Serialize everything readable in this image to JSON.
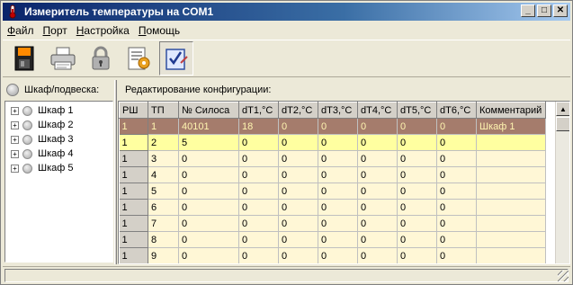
{
  "window": {
    "title": "Измеритель температуры на COM1",
    "minimize": "_",
    "maximize": "□",
    "close": "✕"
  },
  "menu": [
    {
      "label": "Файл",
      "mnemonic": "Ф",
      "rest": "айл"
    },
    {
      "label": "Порт",
      "mnemonic": "П",
      "rest": "орт"
    },
    {
      "label": "Настройка",
      "mnemonic": "Н",
      "rest": "астройка"
    },
    {
      "label": "Помощь",
      "mnemonic": "П",
      "rest": "омощь"
    }
  ],
  "toolbar": {
    "icons": [
      "save-icon",
      "print-icon",
      "lock-icon",
      "settings-icon",
      "check-edit-icon"
    ]
  },
  "left_panel": {
    "header": "Шкаф/подвеска:",
    "tree": [
      {
        "label": "Шкаф 1"
      },
      {
        "label": "Шкаф 2"
      },
      {
        "label": "Шкаф 3"
      },
      {
        "label": "Шкаф 4"
      },
      {
        "label": "Шкаф 5"
      }
    ]
  },
  "right_panel": {
    "header": "Редактирование конфигурации:",
    "columns": [
      "РШ",
      "ТП",
      "№ Силоса",
      "dT1,°C",
      "dT2,°C",
      "dT3,°C",
      "dT4,°C",
      "dT5,°C",
      "dT6,°C",
      "Комментарий"
    ],
    "rows": [
      [
        "1",
        "1",
        "40101",
        "18",
        "0",
        "0",
        "0",
        "0",
        "0",
        "Шкаф 1"
      ],
      [
        "1",
        "2",
        "5",
        "0",
        "0",
        "0",
        "0",
        "0",
        "0",
        ""
      ],
      [
        "1",
        "3",
        "0",
        "0",
        "0",
        "0",
        "0",
        "0",
        "0",
        ""
      ],
      [
        "1",
        "4",
        "0",
        "0",
        "0",
        "0",
        "0",
        "0",
        "0",
        ""
      ],
      [
        "1",
        "5",
        "0",
        "0",
        "0",
        "0",
        "0",
        "0",
        "0",
        ""
      ],
      [
        "1",
        "6",
        "0",
        "0",
        "0",
        "0",
        "0",
        "0",
        "0",
        ""
      ],
      [
        "1",
        "7",
        "0",
        "0",
        "0",
        "0",
        "0",
        "0",
        "0",
        ""
      ],
      [
        "1",
        "8",
        "0",
        "0",
        "0",
        "0",
        "0",
        "0",
        "0",
        ""
      ],
      [
        "1",
        "9",
        "0",
        "0",
        "0",
        "0",
        "0",
        "0",
        "0",
        ""
      ]
    ],
    "selected_row": 0,
    "current_row": 1
  },
  "colors": {
    "title_start": "#0a246a",
    "selected_row": "#a57c6c",
    "current_row": "#ffffa0",
    "cell_bg": "#fff7d6"
  }
}
